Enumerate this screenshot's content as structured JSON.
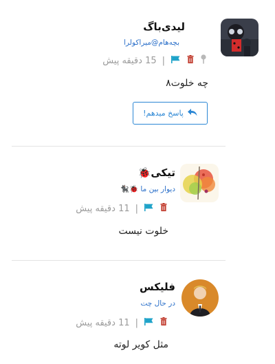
{
  "posts": [
    {
      "name": "لیدی‌باگ",
      "subtitle": "بچه‌هام@میراکولرا",
      "time": "15 دقیقه پیش",
      "separator": "|",
      "text": "چه خلوت۸",
      "reply_label": "پاسخ میدهم!",
      "icons": [
        "pin-icon",
        "trash-icon",
        "flag-icon"
      ],
      "avatar": "ladybug-avatar"
    },
    {
      "name": "تیکی🐞",
      "subtitle": "دیوار بین ما 🐞🐈‍⬛",
      "time": "11 دقیقه پیش",
      "separator": "|",
      "text": "خلوت نیست",
      "icons": [
        "trash-icon",
        "flag-icon"
      ],
      "avatar": "tikki-avatar"
    },
    {
      "name": "فلیکس",
      "subtitle": "در حال چت",
      "time": "11 دقیقه پیش",
      "separator": "|",
      "text": "مثل کویر لوته",
      "icons": [
        "trash-icon",
        "flag-icon"
      ],
      "avatar": "felix-avatar"
    }
  ],
  "colors": {
    "trash": "#c0392b",
    "flag": "#1fa3c9",
    "pin": "#b8b8b8",
    "link": "#2a6fc9",
    "reply_border": "#2a86d4",
    "divider": "#e3e3e3"
  }
}
